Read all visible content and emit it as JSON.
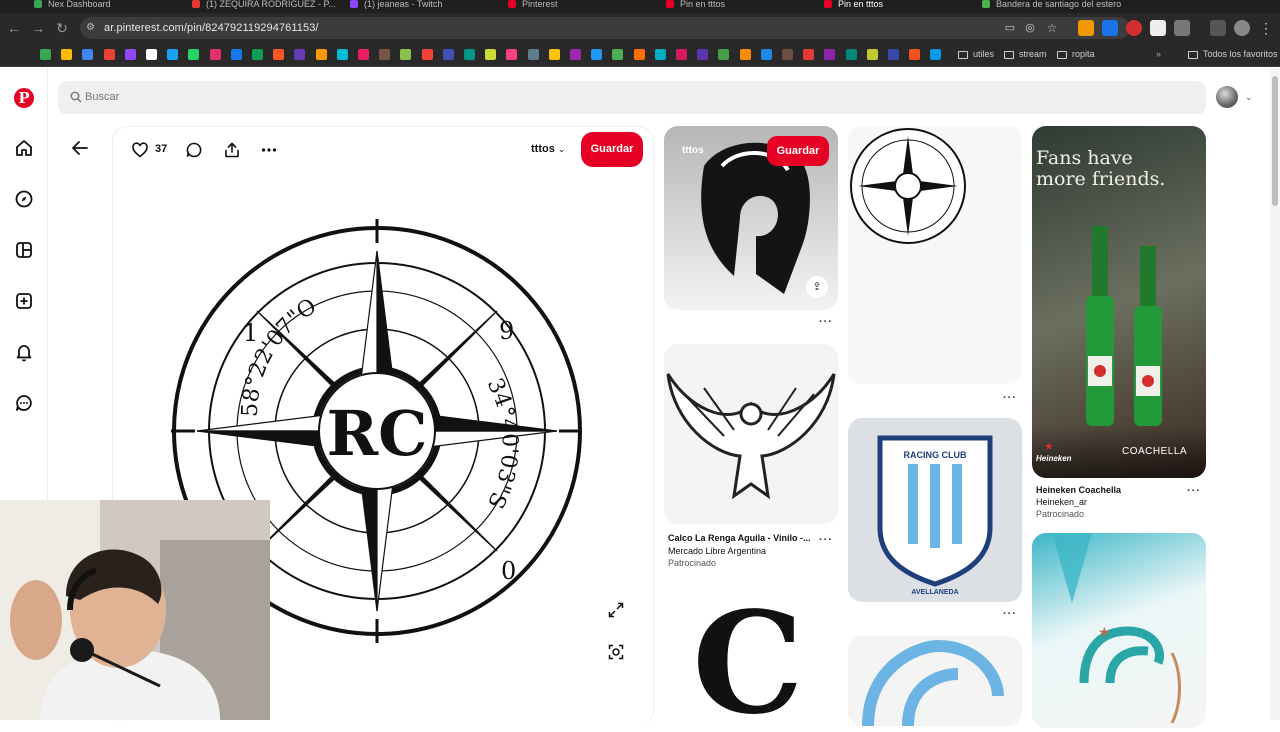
{
  "browser": {
    "tabs": [
      {
        "label": "Nex Dashboard",
        "color": "#34a853"
      },
      {
        "label": "(1) ZEQUIRA RODRIGUEZ - P...",
        "color": "#e53935"
      },
      {
        "label": "(1) jeaneas - Twitch",
        "color": "#9146ff"
      },
      {
        "label": "Pinterest",
        "color": "#e60023"
      },
      {
        "label": "Pin en tttos",
        "color": "#e60023"
      },
      {
        "label": "Pin en tttos",
        "color": "#e60023"
      },
      {
        "label": "Bandera de santiago del estero",
        "color": "#4caf50"
      }
    ],
    "url": "ar.pinterest.com/pin/824792119294761153/",
    "bookmark_folders": [
      "utiles",
      "stream",
      "ropita"
    ],
    "all_bookmarks": "Todos los favoritos"
  },
  "search": {
    "placeholder": "Buscar"
  },
  "pin": {
    "like_count": "37",
    "board_name": "tttos",
    "save_label": "Guardar",
    "image": {
      "top_left_digit": "1",
      "top_right_digit": "9",
      "bottom_right_digit": "0",
      "coord_top": "58°22'07\"O",
      "coord_bottom": "34°40'03\"S",
      "monogram": "RC"
    }
  },
  "grid": {
    "spartan": {
      "board": "tttos",
      "save_label": "Guardar"
    },
    "eagle": {
      "title": "Calco La Renga Aguila - Vinilo -...",
      "subtitle": "Mercado Libre Argentina",
      "promo": "Patrocinado"
    },
    "heineken": {
      "headline_1": "Fans have",
      "headline_2": "more friends.",
      "brand": "Heineken",
      "event": "COACHELLA",
      "title": "Heineken Coachella",
      "subtitle": "Heineken_ar",
      "promo": "Patrocinado"
    },
    "racing": {
      "line_1": "RACING CLUB",
      "line_2": "AVELLANEDA"
    }
  },
  "colors": {
    "brand": "#e60023",
    "racing_blue": "#6cb4e4"
  }
}
